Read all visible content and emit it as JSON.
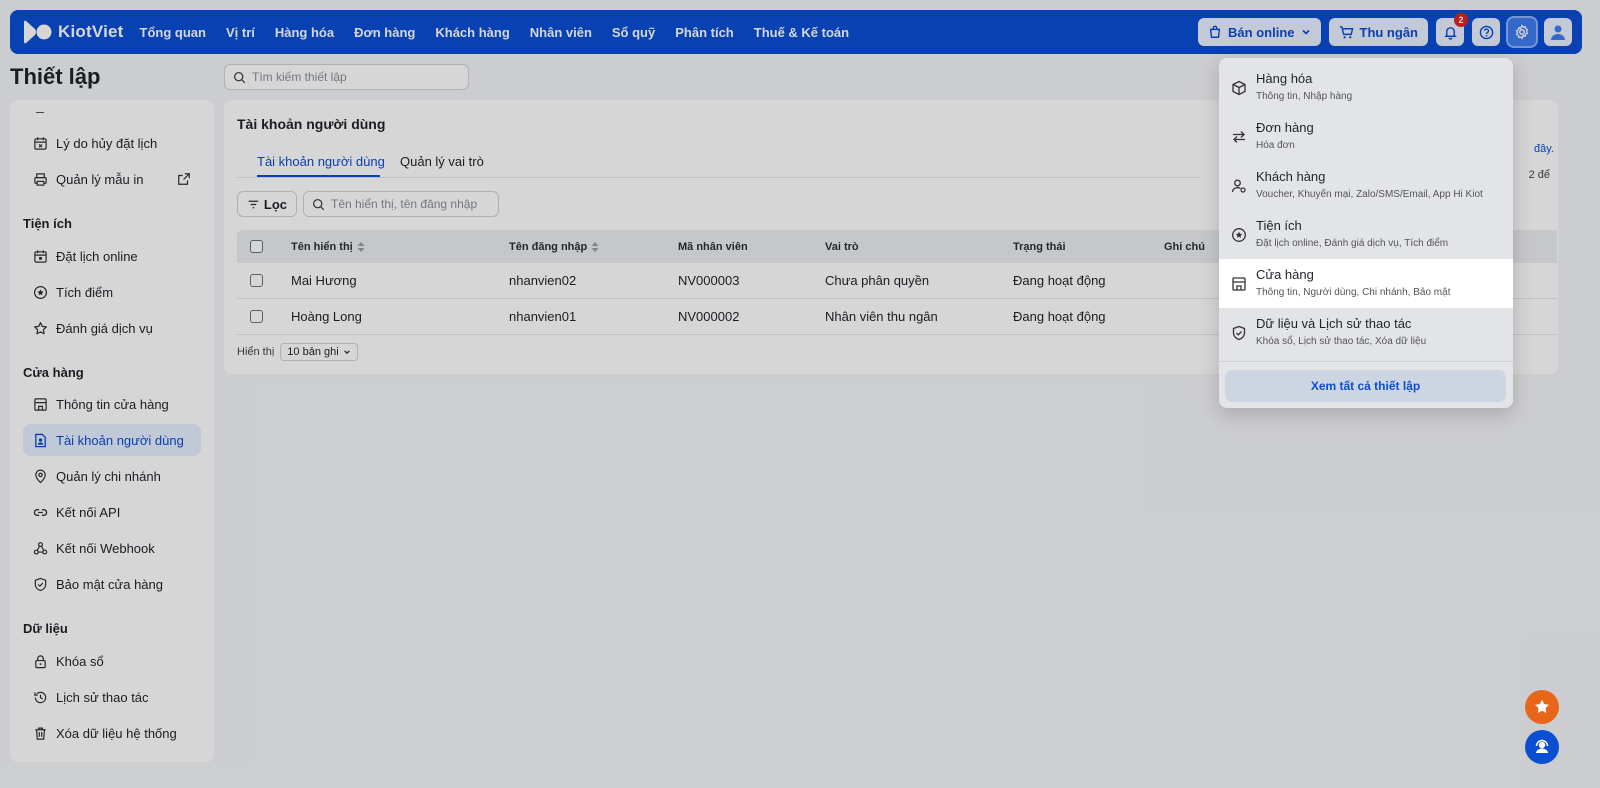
{
  "app": {
    "logo_text": "KiotViet",
    "nav": [
      "Tổng quan",
      "Vị trí",
      "Hàng hóa",
      "Đơn hàng",
      "Khách hàng",
      "Nhân viên",
      "Sổ quỹ",
      "Phân tích",
      "Thuế & Kế toán"
    ],
    "sell_online_label": "Bán online",
    "cashier_label": "Thu ngân",
    "notification_count": "2",
    "brand_color": "#0a4ed4"
  },
  "page": {
    "title": "Thiết lập",
    "search_placeholder": "Tìm kiếm thiết lập"
  },
  "sidebar": {
    "top_items": [
      {
        "label": "Lý do hủy đặt lịch",
        "icon": "calendar-x-icon"
      },
      {
        "label": "Quản lý mẫu in",
        "icon": "printer-icon"
      }
    ],
    "sections": [
      {
        "title": "Tiện ích",
        "items": [
          {
            "label": "Đặt lịch online",
            "icon": "calendar-icon"
          },
          {
            "label": "Tích điểm",
            "icon": "star-circle-icon"
          },
          {
            "label": "Đánh giá dịch vụ",
            "icon": "star-icon"
          }
        ]
      },
      {
        "title": "Cửa hàng",
        "items": [
          {
            "label": "Thông tin cửa hàng",
            "icon": "store-icon"
          },
          {
            "label": "Tài khoản người dùng",
            "icon": "user-file-icon"
          },
          {
            "label": "Quản lý chi nhánh",
            "icon": "location-icon"
          },
          {
            "label": "Kết nối API",
            "icon": "link-icon"
          },
          {
            "label": "Kết nối Webhook",
            "icon": "webhook-icon"
          },
          {
            "label": "Bảo mật cửa hàng",
            "icon": "shield-icon"
          }
        ]
      },
      {
        "title": "Dữ liệu",
        "items": [
          {
            "label": "Khóa sổ",
            "icon": "lock-icon"
          },
          {
            "label": "Lịch sử thao tác",
            "icon": "history-icon"
          },
          {
            "label": "Xóa dữ liệu hệ thống",
            "icon": "trash-icon"
          }
        ]
      }
    ]
  },
  "main": {
    "title": "Tài khoản người dùng",
    "tabs": [
      "Tài khoản người dùng",
      "Quản lý vai trò"
    ],
    "filter_label": "Lọc",
    "search_placeholder": "Tên hiển thị, tên đăng nhập",
    "columns": [
      "Tên hiển thị",
      "Tên đăng nhập",
      "Mã nhân viên",
      "Vai trò",
      "Trạng thái",
      "Ghi chú"
    ],
    "rows": [
      [
        "Mai Hương",
        "nhanvien02",
        "NV000003",
        "Chưa phân quyền",
        "Đang hoạt động",
        ""
      ],
      [
        "Hoàng Long",
        "nhanvien01",
        "NV000002",
        "Nhân viên thu ngân",
        "Đang hoạt động",
        ""
      ]
    ],
    "page_size_label": "Hiển thị",
    "page_size_value": "10 bản ghi"
  },
  "right_card": {
    "fragment_1": "đây.",
    "fragment_2": "2 để"
  },
  "settings_menu": {
    "items": [
      {
        "title": "Hàng hóa",
        "subtitle": "Thông tin, Nhập hàng",
        "icon": "box-icon"
      },
      {
        "title": "Đơn hàng",
        "subtitle": "Hóa đơn",
        "icon": "swap-icon"
      },
      {
        "title": "Khách hàng",
        "subtitle": "Voucher, Khuyến mại, Zalo/SMS/Email, App Hi Kiot",
        "icon": "user-gear-icon"
      },
      {
        "title": "Tiện ích",
        "subtitle": "Đặt lịch online, Đánh giá dịch vụ, Tích điểm",
        "icon": "star-circle-icon"
      },
      {
        "title": "Cửa hàng",
        "subtitle": "Thông tin, Người dùng, Chi nhánh, Bảo mật",
        "icon": "store-icon"
      },
      {
        "title": "Dữ liệu và Lịch sử thao tác",
        "subtitle": "Khóa sổ, Lịch sử thao tác, Xóa dữ liệu",
        "icon": "shield-check-icon"
      }
    ],
    "view_all_label": "Xem tất cả thiết lập"
  }
}
